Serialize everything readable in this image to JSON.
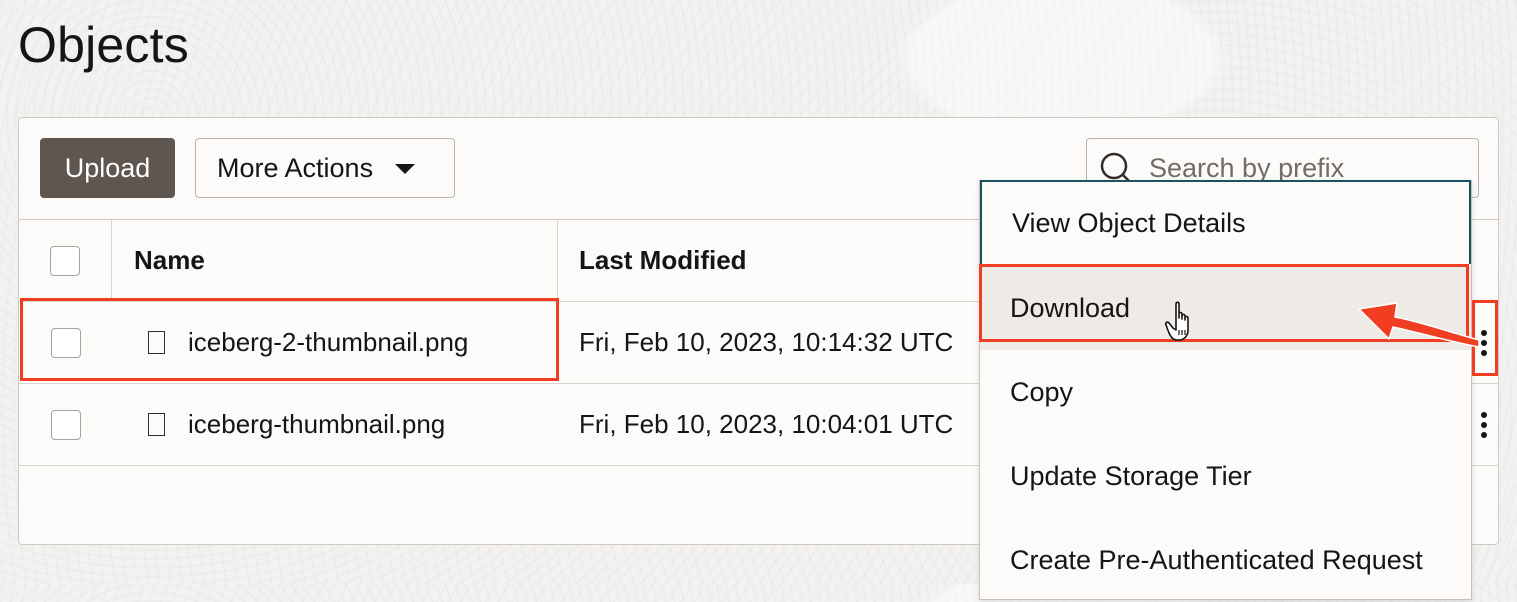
{
  "page": {
    "title": "Objects"
  },
  "toolbar": {
    "upload_label": "Upload",
    "more_actions_label": "More Actions",
    "search_placeholder": "Search by prefix"
  },
  "table": {
    "columns": [
      "Name",
      "Last Modified"
    ],
    "rows": [
      {
        "name": "iceberg-2-thumbnail.png",
        "last_modified": "Fri, Feb 10, 2023, 10:14:32 UTC"
      },
      {
        "name": "iceberg-thumbnail.png",
        "last_modified": "Fri, Feb 10, 2023, 10:04:01 UTC"
      }
    ]
  },
  "context_menu": {
    "items": [
      {
        "label": "View Object Details"
      },
      {
        "label": "Download"
      },
      {
        "label": "Copy"
      },
      {
        "label": "Update Storage Tier"
      },
      {
        "label": "Create Pre-Authenticated Request"
      }
    ]
  },
  "icons": {
    "search": "search-icon",
    "file": "file-icon",
    "caret": "caret-down-icon",
    "actions": "kebab-menu-icon",
    "cursor": "hand-pointer-icon",
    "annotation_arrow": "arrow-icon"
  },
  "colors": {
    "upload_button": "#5f5650",
    "annotation": "#f13e23",
    "focus_ring": "#1c5161",
    "hover_row": "#eeebe7"
  }
}
